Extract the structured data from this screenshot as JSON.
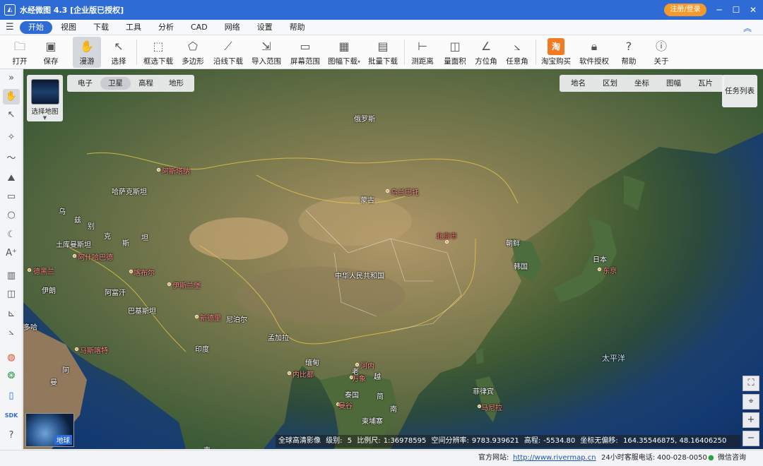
{
  "window": {
    "title": "水经微图 4.3 [企业版已授权]",
    "register": "注册/登录"
  },
  "menu": [
    "开始",
    "视图",
    "下载",
    "工具",
    "分析",
    "CAD",
    "网络",
    "设置",
    "帮助"
  ],
  "toolbar": [
    {
      "label": "打开",
      "icon": "folder-icon"
    },
    {
      "label": "保存",
      "icon": "save-icon"
    },
    {
      "label": "漫游",
      "icon": "hand-icon"
    },
    {
      "label": "选择",
      "icon": "pointer-icon"
    },
    {
      "label": "框选下载",
      "icon": "rect-download-icon"
    },
    {
      "label": "多边形",
      "icon": "polygon-download-icon"
    },
    {
      "label": "沿线下载",
      "icon": "line-download-icon"
    },
    {
      "label": "导入范围",
      "icon": "import-icon"
    },
    {
      "label": "屏幕范围",
      "icon": "screen-icon"
    },
    {
      "label": "图幅下载",
      "icon": "grid-icon"
    },
    {
      "label": "批量下载",
      "icon": "batch-icon"
    },
    {
      "label": "测距离",
      "icon": "ruler-icon"
    },
    {
      "label": "量面积",
      "icon": "area-icon"
    },
    {
      "label": "方位角",
      "icon": "azimuth-icon"
    },
    {
      "label": "任意角",
      "icon": "angle-icon"
    },
    {
      "label": "淘宝购买",
      "icon": "taobao-icon",
      "glyph": "淘"
    },
    {
      "label": "软件授权",
      "icon": "lock-icon"
    },
    {
      "label": "帮助",
      "icon": "help-icon"
    },
    {
      "label": "关于",
      "icon": "info-icon"
    }
  ],
  "map_types": [
    "电子",
    "卫星",
    "高程",
    "地形"
  ],
  "overlays": [
    "地名",
    "区划",
    "坐标",
    "图幅",
    "瓦片"
  ],
  "map_selector_label": "选择地图",
  "task_list": "任务列表",
  "globe_label": "地球",
  "labels": {
    "russia": "俄罗斯",
    "kazakhstan": "哈萨克斯坦",
    "mongolia": "蒙古",
    "china": "中华人民共和国",
    "ulaanbaatar": "乌兰巴托",
    "astana": "阿斯塔纳",
    "beijing": "北京市",
    "nkorea": "朝鲜",
    "skorea": "韩国",
    "japan": "日本",
    "tokyo": "东京",
    "turkmen": "土库曼斯坦",
    "ashgabat": "阿什哈巴德",
    "tehran": "德黑兰",
    "iran": "伊朗",
    "afghan": "阿富汗",
    "kabul": "喀布尔",
    "islamabad": "伊斯兰堡",
    "pakistan": "巴基斯坦",
    "newdelhi": "新德里",
    "nepal": "尼泊尔",
    "india": "印度",
    "muscat": "马斯喀特",
    "oman1": "阿",
    "oman2": "曼",
    "myanmar": "缅甸",
    "naypyidaw": "内比都",
    "bangladesh": "孟加拉",
    "hanoi": "河内",
    "vientiane": "万象",
    "laos": "老",
    "viet1": "越",
    "viet2": "南",
    "thailand": "泰国",
    "bangkok": "曼谷",
    "cambodia": "柬埔寨",
    "philippines": "菲律宾",
    "manila": "马尼拉",
    "pacific": "太平洋",
    "uz1": "乌",
    "uz2": "兹",
    "uz3": "别",
    "uz4": "克",
    "uz5": "斯",
    "tj": "坦",
    "doha": "多哈",
    "jin": "简",
    "gei": "柬"
  },
  "infobar": {
    "source": "全球高清影像",
    "level_label": "级别:",
    "level": "5",
    "scale_label": "比例尺:",
    "scale": "1:36978595",
    "res_label": "空间分辨率:",
    "res": "9783.939621",
    "elev_label": "高程:",
    "elev": "-5534.80",
    "coord_label": "坐标无偏移:",
    "coord": "164.35546875, 48.16406250"
  },
  "status": {
    "site_label": "官方网站:",
    "site": "http://www.rivermap.cn",
    "phone_label": "24小时客服电话:",
    "phone": "400-028-0050",
    "wechat": "微信咨询"
  },
  "colors": {
    "brand": "#2f6bd4",
    "accent": "#f39a2b"
  }
}
